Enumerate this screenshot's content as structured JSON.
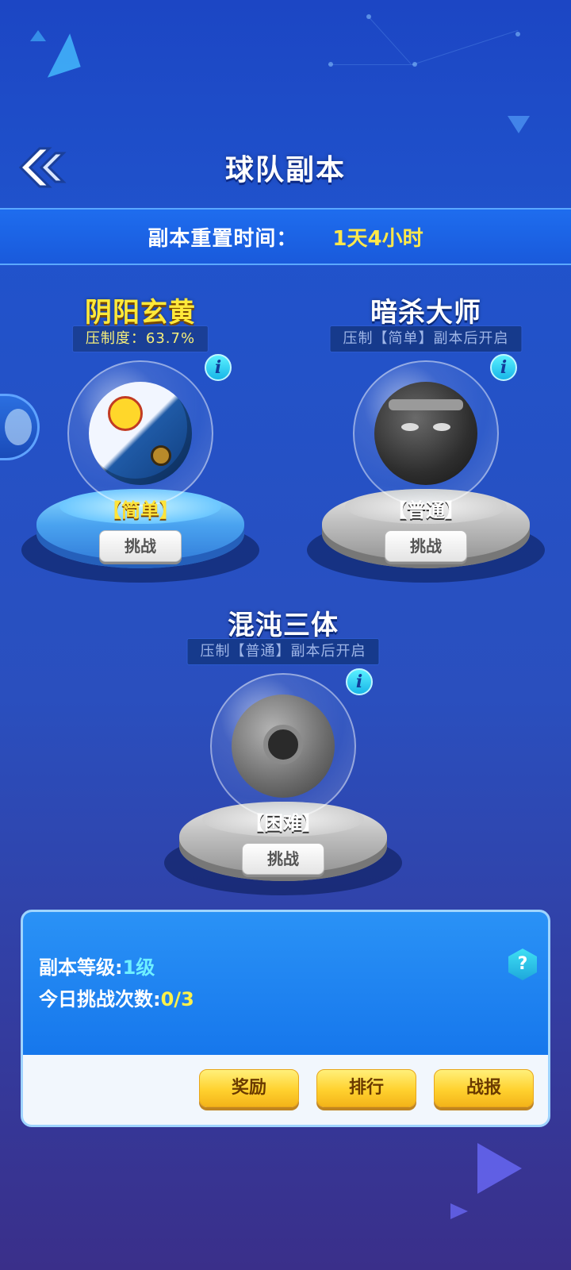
{
  "header": {
    "title": "球队副本",
    "back_icon": "double-chevron-left-icon"
  },
  "reset": {
    "label": "副本重置时间：",
    "value": "1天4小时"
  },
  "dungeons": [
    {
      "name": "阴阳玄黄",
      "status": "压制度：63.7%",
      "difficulty": "【简单】",
      "button": "挑战",
      "unlocked": true,
      "theme": "blue"
    },
    {
      "name": "暗杀大师",
      "status": "压制【简单】副本后开启",
      "difficulty": "【普通】",
      "button": "挑战",
      "unlocked": false,
      "theme": "gray"
    },
    {
      "name": "混沌三体",
      "status": "压制【普通】副本后开启",
      "difficulty": "【困难】",
      "button": "挑战",
      "unlocked": false,
      "theme": "gray"
    }
  ],
  "panel": {
    "level_label": "副本等级:",
    "level_value": "1级",
    "attempts_label": "今日挑战次数:",
    "attempts_value": "0/3",
    "help_icon": "question-icon",
    "buttons": {
      "reward": "奖励",
      "rank": "排行",
      "report": "战报"
    }
  },
  "colors": {
    "accent_yellow": "#ffe93a",
    "background_blue": "#2053cc",
    "panel_blue": "#1677ec",
    "gold_button": "#ffd12e"
  }
}
